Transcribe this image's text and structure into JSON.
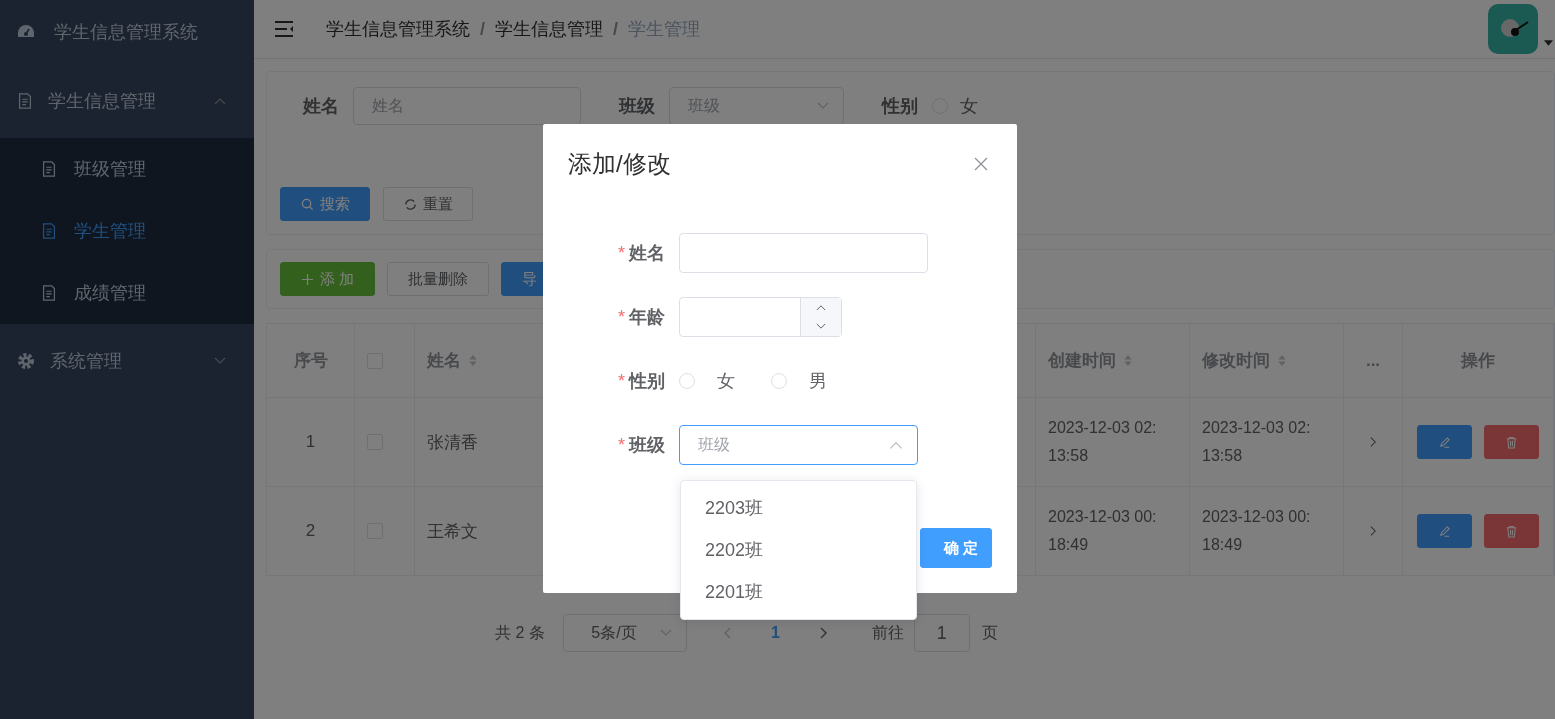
{
  "sidebar": {
    "title": "学生信息管理系统",
    "menu": [
      {
        "label": "学生信息管理",
        "expanded": true,
        "children": [
          {
            "label": "班级管理",
            "selected": false
          },
          {
            "label": "学生管理",
            "selected": true
          },
          {
            "label": "成绩管理",
            "selected": false
          }
        ]
      },
      {
        "label": "系统管理",
        "expanded": false
      }
    ]
  },
  "header": {
    "separator": "/",
    "breadcrumb": [
      "学生信息管理系统",
      "学生信息管理",
      "学生管理"
    ]
  },
  "search": {
    "fields": [
      {
        "kind": "input",
        "label": "姓名",
        "placeholder": "姓名"
      },
      {
        "kind": "select",
        "label": "班级",
        "placeholder": "班级"
      },
      {
        "kind": "radio",
        "label": "性别",
        "options": [
          {
            "label": "女",
            "selected": false
          }
        ]
      }
    ],
    "buttons": [
      {
        "kind": "primary",
        "label": "搜索"
      },
      {
        "kind": "default",
        "label": "重置"
      }
    ]
  },
  "toolbar": [
    {
      "kind": "success",
      "label": "添 加"
    },
    {
      "kind": "default",
      "label": "批量删除"
    },
    {
      "kind": "primary",
      "label": "导"
    }
  ],
  "table": {
    "columns": [
      {
        "kind": "text",
        "label": "序号"
      },
      {
        "kind": "checkbox",
        "checked": false
      },
      {
        "kind": "sort",
        "label": "姓名"
      },
      {
        "kind": "sort",
        "label": "创建时间"
      },
      {
        "kind": "sort",
        "label": "修改时间"
      },
      {
        "kind": "text",
        "label": "..."
      },
      {
        "kind": "text",
        "label": "操作"
      }
    ],
    "rows": [
      {
        "index": "1",
        "checked": false,
        "name": "张清香",
        "created": "2023-12-03 02:13:58",
        "modified": "2023-12-03 02:13:58"
      },
      {
        "index": "2",
        "checked": false,
        "name": "王希文",
        "created": "2023-12-03 00:18:49",
        "modified": "2023-12-03 00:18:49"
      }
    ]
  },
  "pagination": {
    "total": "共 2 条",
    "page_size": "5条/页",
    "pages": [
      {
        "label": "1",
        "selected": true
      }
    ],
    "jump_label": "前往",
    "jump_value": "1",
    "jump_suffix": "页"
  },
  "dialog": {
    "title": "添加/修改",
    "required_mark": "*",
    "fields": [
      {
        "kind": "input",
        "label": "姓名",
        "required": true
      },
      {
        "kind": "number",
        "label": "年龄",
        "required": true
      },
      {
        "kind": "radio",
        "label": "性别",
        "required": true,
        "options": [
          {
            "label": "女",
            "selected": false
          },
          {
            "label": "男",
            "selected": false
          }
        ]
      },
      {
        "kind": "select",
        "label": "班级",
        "required": true,
        "placeholder": "班级",
        "expanded": true,
        "options": [
          "2203班",
          "2202班",
          "2201班"
        ]
      }
    ],
    "confirm": "确 定"
  }
}
